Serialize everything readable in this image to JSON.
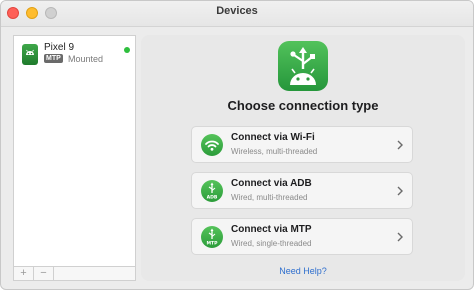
{
  "window": {
    "title": "Devices"
  },
  "sidebar": {
    "devices": [
      {
        "name": "Pixel 9",
        "mode_tag": "MTP",
        "status": "Mounted",
        "status_color": "#2fbf3e"
      }
    ],
    "footer": {
      "add_label": "+",
      "remove_label": "−"
    }
  },
  "main": {
    "heading": "Choose connection type",
    "options": [
      {
        "title": "Connect via Wi-Fi",
        "subtitle": "Wireless, multi-threaded",
        "icon": "wifi-icon"
      },
      {
        "title": "Connect via ADB",
        "subtitle": "Wired, multi-threaded",
        "icon": "usb-adb-icon",
        "badge": "ADB"
      },
      {
        "title": "Connect via MTP",
        "subtitle": "Wired, single-threaded",
        "icon": "usb-mtp-icon",
        "badge": "MTP"
      }
    ],
    "help_link": "Need Help?"
  },
  "colors": {
    "accent_green": "#34a853",
    "link_blue": "#2f6fce"
  }
}
